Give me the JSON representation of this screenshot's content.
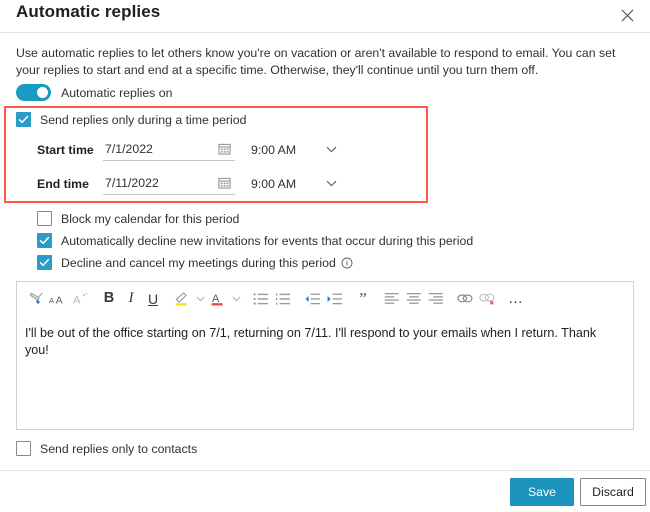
{
  "header": {
    "title": "Automatic replies",
    "close_icon": "close-icon"
  },
  "description": "Use automatic replies to let others know you're on vacation or aren't available to respond to email. You can set your replies to start and end at a specific time. Otherwise, they'll continue until you turn them off.",
  "toggle": {
    "label": "Automatic replies on",
    "state": "on",
    "color": "#1b9bc4"
  },
  "time_period": {
    "checkbox_label": "Send replies only during a time period",
    "checked": true,
    "start": {
      "label": "Start time",
      "date": "7/1/2022",
      "time": "9:00 AM",
      "calendar_icon": "calendar-icon",
      "chevron_icon": "chevron-down-icon"
    },
    "end": {
      "label": "End time",
      "date": "7/11/2022",
      "time": "9:00 AM",
      "calendar_icon": "calendar-icon",
      "chevron_icon": "chevron-down-icon"
    },
    "highlight_color": "#fc5a51"
  },
  "options": [
    {
      "label": "Block my calendar for this period",
      "checked": false,
      "info": false
    },
    {
      "label": "Automatically decline new invitations for events that occur during this period",
      "checked": true,
      "info": false
    },
    {
      "label": "Decline and cancel my meetings during this period",
      "checked": true,
      "info": true,
      "info_icon": "info-circle-icon"
    }
  ],
  "editor": {
    "toolbar": [
      {
        "name": "format-painter-icon",
        "label": ""
      },
      {
        "name": "font-size-icon",
        "label": ""
      },
      {
        "name": "clear-formatting-icon",
        "label": ""
      },
      {
        "name": "bold-icon",
        "label": "B"
      },
      {
        "name": "italic-icon",
        "label": "I"
      },
      {
        "name": "underline-icon",
        "label": "U"
      },
      {
        "name": "highlight-color-icon",
        "label": ""
      },
      {
        "name": "font-color-icon",
        "label": ""
      },
      {
        "name": "bulleted-list-icon",
        "label": ""
      },
      {
        "name": "numbered-list-icon",
        "label": ""
      },
      {
        "name": "decrease-indent-icon",
        "label": ""
      },
      {
        "name": "increase-indent-icon",
        "label": ""
      },
      {
        "name": "quote-icon",
        "label": "”"
      },
      {
        "name": "align-left-icon",
        "label": ""
      },
      {
        "name": "align-center-icon",
        "label": ""
      },
      {
        "name": "align-right-icon",
        "label": ""
      },
      {
        "name": "insert-link-icon",
        "label": ""
      },
      {
        "name": "remove-link-icon",
        "label": ""
      },
      {
        "name": "more-options-icon",
        "label": "…"
      }
    ],
    "body": "I'll be out of the office starting on 7/1, returning on 7/11. I'll respond to your emails when I return. Thank you!"
  },
  "contacts_option": {
    "label": "Send replies only to contacts",
    "checked": false
  },
  "footer": {
    "save_label": "Save",
    "save_color": "#1b93bd",
    "discard_label": "Discard"
  }
}
